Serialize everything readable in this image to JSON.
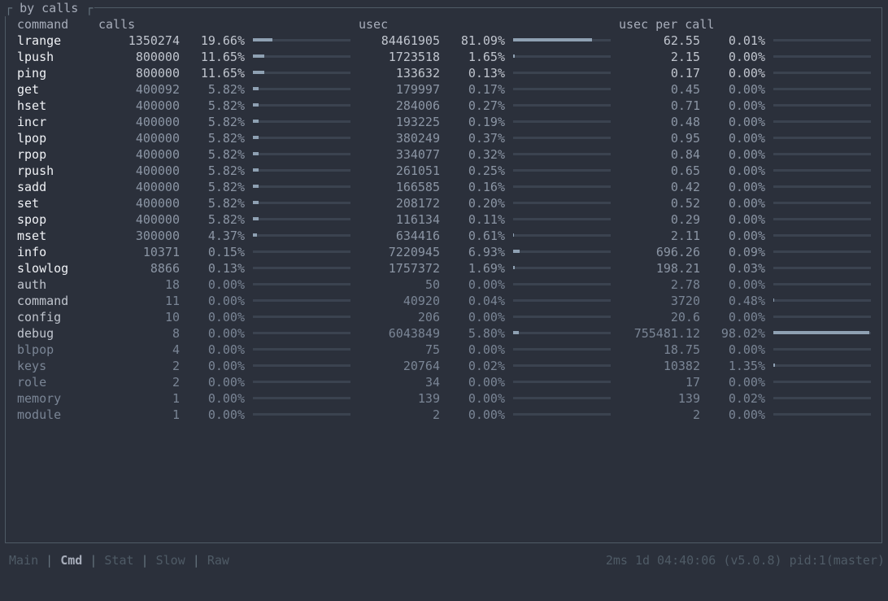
{
  "panel": {
    "title": "by calls"
  },
  "headers": {
    "command": "command",
    "calls": "calls",
    "usec": "usec",
    "usec_per_call": "usec per call"
  },
  "colors": {
    "fg_bright": "#eff1f5",
    "fg_mid": "#c0c5ce",
    "fg_dim": "#8b95a4",
    "fg_dimmer": "#7a8595",
    "bar_track": "#3b4350",
    "bar_fill": "#8fa1b3"
  },
  "rows": [
    {
      "name": "lrange",
      "calls": "1350274",
      "calls_pct": "19.66%",
      "calls_frac": 0.1966,
      "usec": "84461905",
      "usec_pct": "81.09%",
      "usec_frac": 0.8109,
      "upc": "62.55",
      "upc_pct": "0.01%",
      "upc_frac": 0.0001
    },
    {
      "name": "lpush",
      "calls": "800000",
      "calls_pct": "11.65%",
      "calls_frac": 0.1165,
      "usec": "1723518",
      "usec_pct": "1.65%",
      "usec_frac": 0.0165,
      "upc": "2.15",
      "upc_pct": "0.00%",
      "upc_frac": 0
    },
    {
      "name": "ping",
      "calls": "800000",
      "calls_pct": "11.65%",
      "calls_frac": 0.1165,
      "usec": "133632",
      "usec_pct": "0.13%",
      "usec_frac": 0.0013,
      "upc": "0.17",
      "upc_pct": "0.00%",
      "upc_frac": 0
    },
    {
      "name": "get",
      "calls": "400092",
      "calls_pct": "5.82%",
      "calls_frac": 0.0582,
      "usec": "179997",
      "usec_pct": "0.17%",
      "usec_frac": 0.0017,
      "upc": "0.45",
      "upc_pct": "0.00%",
      "upc_frac": 0
    },
    {
      "name": "hset",
      "calls": "400000",
      "calls_pct": "5.82%",
      "calls_frac": 0.0582,
      "usec": "284006",
      "usec_pct": "0.27%",
      "usec_frac": 0.0027,
      "upc": "0.71",
      "upc_pct": "0.00%",
      "upc_frac": 0
    },
    {
      "name": "incr",
      "calls": "400000",
      "calls_pct": "5.82%",
      "calls_frac": 0.0582,
      "usec": "193225",
      "usec_pct": "0.19%",
      "usec_frac": 0.0019,
      "upc": "0.48",
      "upc_pct": "0.00%",
      "upc_frac": 0
    },
    {
      "name": "lpop",
      "calls": "400000",
      "calls_pct": "5.82%",
      "calls_frac": 0.0582,
      "usec": "380249",
      "usec_pct": "0.37%",
      "usec_frac": 0.0037,
      "upc": "0.95",
      "upc_pct": "0.00%",
      "upc_frac": 0
    },
    {
      "name": "rpop",
      "calls": "400000",
      "calls_pct": "5.82%",
      "calls_frac": 0.0582,
      "usec": "334077",
      "usec_pct": "0.32%",
      "usec_frac": 0.0032,
      "upc": "0.84",
      "upc_pct": "0.00%",
      "upc_frac": 0
    },
    {
      "name": "rpush",
      "calls": "400000",
      "calls_pct": "5.82%",
      "calls_frac": 0.0582,
      "usec": "261051",
      "usec_pct": "0.25%",
      "usec_frac": 0.0025,
      "upc": "0.65",
      "upc_pct": "0.00%",
      "upc_frac": 0
    },
    {
      "name": "sadd",
      "calls": "400000",
      "calls_pct": "5.82%",
      "calls_frac": 0.0582,
      "usec": "166585",
      "usec_pct": "0.16%",
      "usec_frac": 0.0016,
      "upc": "0.42",
      "upc_pct": "0.00%",
      "upc_frac": 0
    },
    {
      "name": "set",
      "calls": "400000",
      "calls_pct": "5.82%",
      "calls_frac": 0.0582,
      "usec": "208172",
      "usec_pct": "0.20%",
      "usec_frac": 0.002,
      "upc": "0.52",
      "upc_pct": "0.00%",
      "upc_frac": 0
    },
    {
      "name": "spop",
      "calls": "400000",
      "calls_pct": "5.82%",
      "calls_frac": 0.0582,
      "usec": "116134",
      "usec_pct": "0.11%",
      "usec_frac": 0.0011,
      "upc": "0.29",
      "upc_pct": "0.00%",
      "upc_frac": 0
    },
    {
      "name": "mset",
      "calls": "300000",
      "calls_pct": "4.37%",
      "calls_frac": 0.0437,
      "usec": "634416",
      "usec_pct": "0.61%",
      "usec_frac": 0.0061,
      "upc": "2.11",
      "upc_pct": "0.00%",
      "upc_frac": 0
    },
    {
      "name": "info",
      "calls": "10371",
      "calls_pct": "0.15%",
      "calls_frac": 0.0015,
      "usec": "7220945",
      "usec_pct": "6.93%",
      "usec_frac": 0.0693,
      "upc": "696.26",
      "upc_pct": "0.09%",
      "upc_frac": 0.0009
    },
    {
      "name": "slowlog",
      "calls": "8866",
      "calls_pct": "0.13%",
      "calls_frac": 0.0013,
      "usec": "1757372",
      "usec_pct": "1.69%",
      "usec_frac": 0.0169,
      "upc": "198.21",
      "upc_pct": "0.03%",
      "upc_frac": 0.0003
    },
    {
      "name": "auth",
      "calls": "18",
      "calls_pct": "0.00%",
      "calls_frac": 0,
      "usec": "50",
      "usec_pct": "0.00%",
      "usec_frac": 0,
      "upc": "2.78",
      "upc_pct": "0.00%",
      "upc_frac": 0
    },
    {
      "name": "command",
      "calls": "11",
      "calls_pct": "0.00%",
      "calls_frac": 0,
      "usec": "40920",
      "usec_pct": "0.04%",
      "usec_frac": 0.0004,
      "upc": "3720",
      "upc_pct": "0.48%",
      "upc_frac": 0.0048
    },
    {
      "name": "config",
      "calls": "10",
      "calls_pct": "0.00%",
      "calls_frac": 0,
      "usec": "206",
      "usec_pct": "0.00%",
      "usec_frac": 0,
      "upc": "20.6",
      "upc_pct": "0.00%",
      "upc_frac": 0
    },
    {
      "name": "debug",
      "calls": "8",
      "calls_pct": "0.00%",
      "calls_frac": 0,
      "usec": "6043849",
      "usec_pct": "5.80%",
      "usec_frac": 0.058,
      "upc": "755481.12",
      "upc_pct": "98.02%",
      "upc_frac": 0.9802
    },
    {
      "name": "blpop",
      "calls": "4",
      "calls_pct": "0.00%",
      "calls_frac": 0,
      "usec": "75",
      "usec_pct": "0.00%",
      "usec_frac": 0,
      "upc": "18.75",
      "upc_pct": "0.00%",
      "upc_frac": 0
    },
    {
      "name": "keys",
      "calls": "2",
      "calls_pct": "0.00%",
      "calls_frac": 0,
      "usec": "20764",
      "usec_pct": "0.02%",
      "usec_frac": 0.0002,
      "upc": "10382",
      "upc_pct": "1.35%",
      "upc_frac": 0.0135
    },
    {
      "name": "role",
      "calls": "2",
      "calls_pct": "0.00%",
      "calls_frac": 0,
      "usec": "34",
      "usec_pct": "0.00%",
      "usec_frac": 0,
      "upc": "17",
      "upc_pct": "0.00%",
      "upc_frac": 0
    },
    {
      "name": "memory",
      "calls": "1",
      "calls_pct": "0.00%",
      "calls_frac": 0,
      "usec": "139",
      "usec_pct": "0.00%",
      "usec_frac": 0,
      "upc": "139",
      "upc_pct": "0.02%",
      "upc_frac": 0.0002
    },
    {
      "name": "module",
      "calls": "1",
      "calls_pct": "0.00%",
      "calls_frac": 0,
      "usec": "2",
      "usec_pct": "0.00%",
      "usec_frac": 0,
      "upc": "2",
      "upc_pct": "0.00%",
      "upc_frac": 0
    }
  ],
  "tabs": [
    {
      "label": "Main",
      "active": false
    },
    {
      "label": "Cmd",
      "active": true
    },
    {
      "label": "Stat",
      "active": false
    },
    {
      "label": "Slow",
      "active": false
    },
    {
      "label": "Raw",
      "active": false
    }
  ],
  "tab_separator": " | ",
  "status": {
    "latency": "2ms",
    "uptime": "1d 04:40:06",
    "version": "(v5.0.8)",
    "pid": "pid:1(master)"
  }
}
